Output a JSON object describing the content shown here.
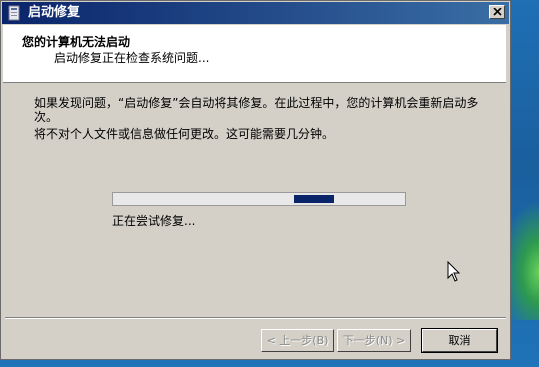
{
  "window": {
    "title": "启动修复"
  },
  "header": {
    "title": "您的计算机无法启动",
    "subtitle": "启动修复正在检查系统问题..."
  },
  "content": {
    "paragraph1": "如果发现问题，“启动修复”会自动将其修复。在此过程中，您的计算机会重新启动多次。",
    "paragraph2": "将不对个人文件或信息做任何更改。这可能需要几分钟。",
    "status": "正在尝试修复..."
  },
  "buttons": {
    "back": "< 上一步(B)",
    "next": "下一步(N) >",
    "cancel": "取消"
  },
  "colors": {
    "progress_fill": "#0a246a",
    "titlebar": "#0a246a"
  }
}
